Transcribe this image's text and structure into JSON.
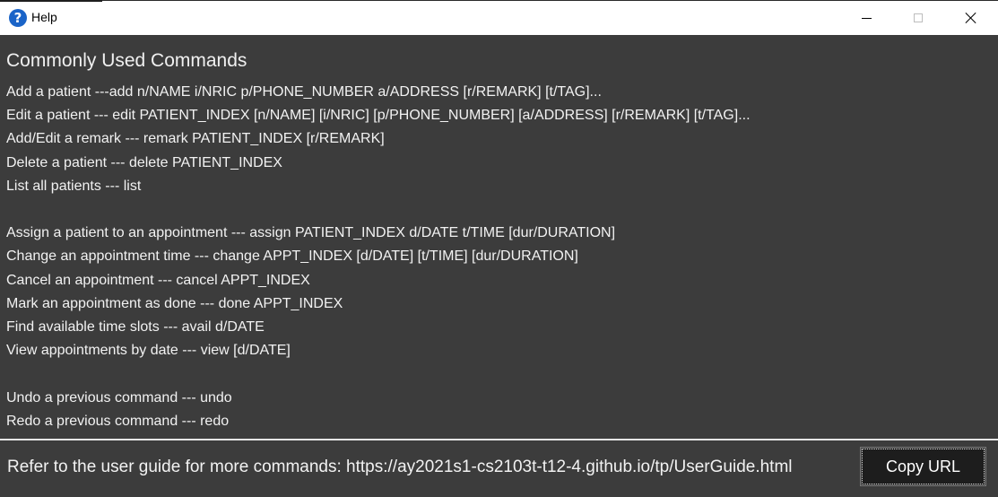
{
  "window": {
    "title": "Help",
    "icon": "question-mark-icon",
    "controls": [
      "minimize-icon",
      "maximize-icon",
      "close-icon"
    ]
  },
  "main": {
    "heading": "Commonly Used Commands",
    "group1": [
      "Add a patient ---add n/NAME i/NRIC p/PHONE_NUMBER a/ADDRESS [r/REMARK] [t/TAG]...",
      "Edit a patient --- edit PATIENT_INDEX [n/NAME] [i/NRIC] [p/PHONE_NUMBER] [a/ADDRESS] [r/REMARK] [t/TAG]...",
      "Add/Edit a remark --- remark PATIENT_INDEX [r/REMARK]",
      "Delete a patient --- delete PATIENT_INDEX",
      "List all patients --- list"
    ],
    "group2": [
      "Assign a patient to an appointment --- assign PATIENT_INDEX d/DATE t/TIME [dur/DURATION]",
      "Change an appointment time --- change APPT_INDEX [d/DATE] [t/TIME] [dur/DURATION]",
      "Cancel an appointment --- cancel APPT_INDEX",
      "Mark an appointment as done --- done APPT_INDEX",
      "Find available time slots --- avail d/DATE",
      "View appointments by date --- view [d/DATE]"
    ],
    "group3": [
      "Undo a previous command --- undo",
      "Redo a previous command --- redo"
    ]
  },
  "footer": {
    "text": "Refer to the user guide for more commands: https://ay2021s1-cs2103t-t12-4.github.io/tp/UserGuide.html",
    "copy_button": "Copy URL"
  },
  "colors": {
    "background": "#3c3c3c",
    "text": "#ffffff",
    "button_bg": "#1d1d1d",
    "icon_blue": "#1a64c8"
  }
}
